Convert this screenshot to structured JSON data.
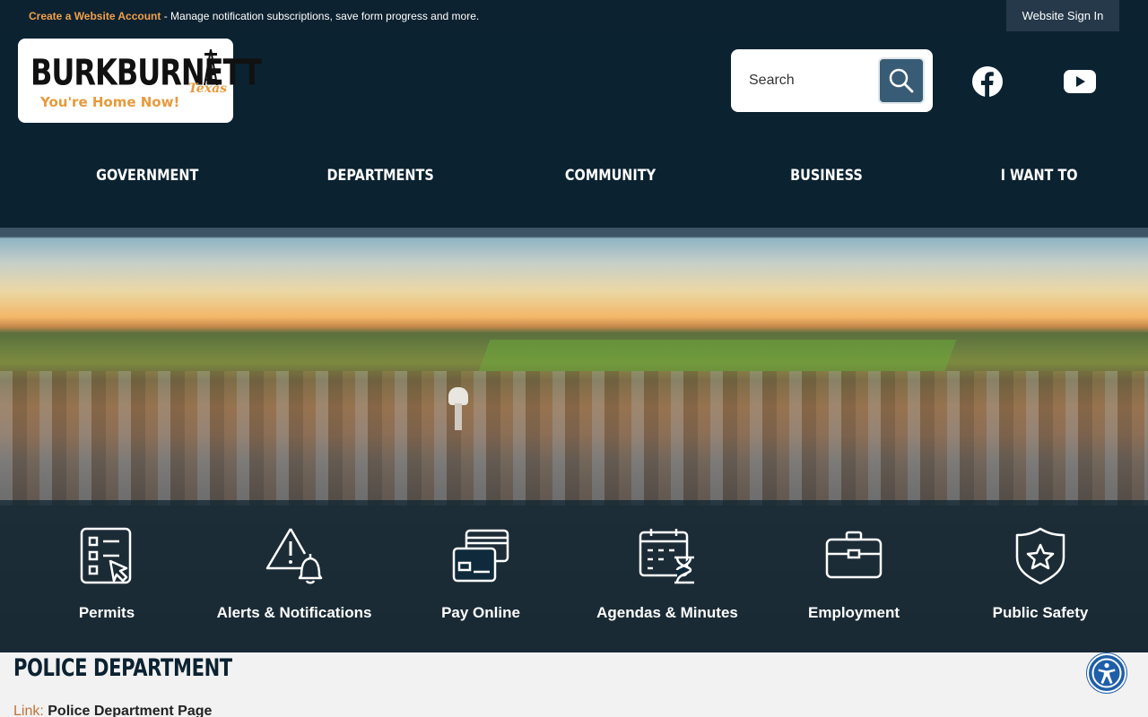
{
  "topbar": {
    "create_account": "Create a Website Account",
    "create_account_rest": " - Manage notification subscriptions, save form progress and more.",
    "sign_in": "Website Sign In"
  },
  "logo": {
    "name": "BURKBURNETT",
    "state": "Texas",
    "tagline": "You're Home Now!"
  },
  "search": {
    "placeholder": "Search"
  },
  "social": [
    "facebook-icon",
    "youtube-icon"
  ],
  "nav": {
    "items": [
      "GOVERNMENT",
      "DEPARTMENTS",
      "COMMUNITY",
      "BUSINESS",
      "I WANT TO"
    ]
  },
  "quick_links": [
    {
      "label": "Permits",
      "icon": "permits-checklist-icon"
    },
    {
      "label": "Alerts & Notifications",
      "icon": "alert-bell-icon"
    },
    {
      "label": "Pay Online",
      "icon": "credit-card-icon"
    },
    {
      "label": "Agendas & Minutes",
      "icon": "calendar-hourglass-icon"
    },
    {
      "label": "Employment",
      "icon": "briefcase-icon"
    },
    {
      "label": "Public Safety",
      "icon": "shield-star-icon"
    }
  ],
  "content": {
    "title": "POLICE DEPARTMENT",
    "link_label": "Link:",
    "link_text": "Police Department Page"
  },
  "colors": {
    "header_bg": "#0b2231",
    "accent_orange": "#e79a3c",
    "search_button": "#385c75"
  }
}
